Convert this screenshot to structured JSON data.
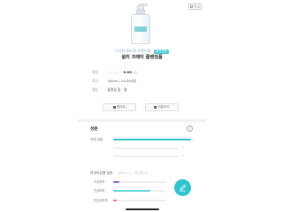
{
  "header": {
    "compare_label": "비교"
  },
  "product": {
    "brand": "닥터지 (Dr.G) 브랜드명",
    "badge": "클렌징폼",
    "name": "설리 크레미 클렌징폼"
  },
  "info": {
    "rating_key": "평점",
    "rating_dim": "☆☆☆☆☆",
    "rating_value": "0.00",
    "rating_unit": "(0)",
    "price_key": "정가",
    "price_value": "300ml / 24,000원",
    "category_key": "랭킹",
    "category_value": "클렌징 폼 · 젤"
  },
  "actions": {
    "left_label": "좋아요",
    "right_label": "리뷰쓰기"
  },
  "components": {
    "title": "성분",
    "help": "?",
    "overall_label": "전체 성분",
    "overall_fill": 0.96,
    "row2_fill": 0.0,
    "row3_fill": 0.0,
    "tick_a": "0",
    "tick_b": "0",
    "color_accent": "#2ec4cc"
  },
  "skin": {
    "title": "피부타입별 성분",
    "legend": "pH 5~7 · 약산성 0",
    "rows": [
      {
        "label": "지성피부",
        "fill": 0.12,
        "color": "#9b6ad1"
      },
      {
        "label": "건성피부",
        "fill": 0.7,
        "color": "#5fd6dc"
      },
      {
        "label": "민감성피부",
        "fill": 0.06,
        "color": "#f06a6a"
      }
    ]
  }
}
